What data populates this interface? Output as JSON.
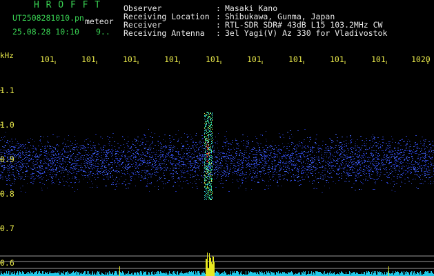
{
  "header": {
    "app_title": "H R O F F T",
    "filename": "UT2508281010.pn",
    "filename_suffix": "meteor",
    "datetime": "25.08.28 10:10",
    "count": "9.."
  },
  "info": {
    "labels": [
      "Observer",
      "Receiving Location",
      "Receiver",
      "Receiving Antenna"
    ],
    "values": [
      "Masaki Kano",
      "Shibukawa, Gunma, Japan",
      "RTL-SDR SDR# 43dB L15 103.2MHz CW",
      "3el Yagi(V) Az 330 for Vladivostok"
    ]
  },
  "axes": {
    "khz_label": "kHz",
    "x_ticks": [
      "101",
      "101",
      "101",
      "101",
      "101",
      "101",
      "101",
      "101",
      "101",
      "1020"
    ],
    "y_ticks": [
      "1.1",
      "1.0",
      "0.9",
      "0.8",
      "0.7",
      "0.6"
    ]
  },
  "colors": {
    "background": "#000000",
    "header_green": "#39d353",
    "text_white": "#eaeaea",
    "tick_yellow": "#e8e84a",
    "noise_blue": "#2233aa",
    "signal_cyan": "#30e0e0",
    "signal_red": "#ff3030",
    "baseline_cyan": "#20c8e8"
  }
}
